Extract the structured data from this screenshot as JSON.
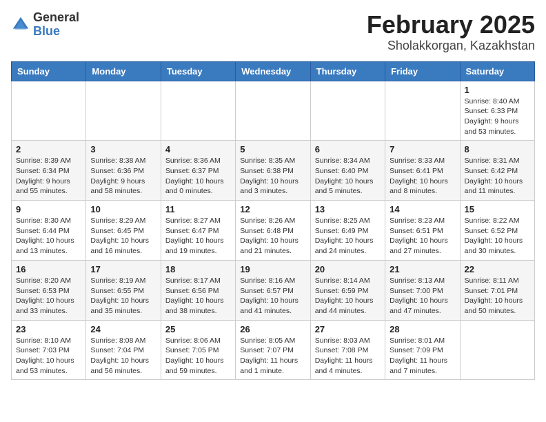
{
  "logo": {
    "general": "General",
    "blue": "Blue"
  },
  "title": {
    "main": "February 2025",
    "sub": "Sholakkorgan, Kazakhstan"
  },
  "weekdays": [
    "Sunday",
    "Monday",
    "Tuesday",
    "Wednesday",
    "Thursday",
    "Friday",
    "Saturday"
  ],
  "weeks": [
    [
      {
        "day": "",
        "info": ""
      },
      {
        "day": "",
        "info": ""
      },
      {
        "day": "",
        "info": ""
      },
      {
        "day": "",
        "info": ""
      },
      {
        "day": "",
        "info": ""
      },
      {
        "day": "",
        "info": ""
      },
      {
        "day": "1",
        "info": "Sunrise: 8:40 AM\nSunset: 6:33 PM\nDaylight: 9 hours and 53 minutes."
      }
    ],
    [
      {
        "day": "2",
        "info": "Sunrise: 8:39 AM\nSunset: 6:34 PM\nDaylight: 9 hours and 55 minutes."
      },
      {
        "day": "3",
        "info": "Sunrise: 8:38 AM\nSunset: 6:36 PM\nDaylight: 9 hours and 58 minutes."
      },
      {
        "day": "4",
        "info": "Sunrise: 8:36 AM\nSunset: 6:37 PM\nDaylight: 10 hours and 0 minutes."
      },
      {
        "day": "5",
        "info": "Sunrise: 8:35 AM\nSunset: 6:38 PM\nDaylight: 10 hours and 3 minutes."
      },
      {
        "day": "6",
        "info": "Sunrise: 8:34 AM\nSunset: 6:40 PM\nDaylight: 10 hours and 5 minutes."
      },
      {
        "day": "7",
        "info": "Sunrise: 8:33 AM\nSunset: 6:41 PM\nDaylight: 10 hours and 8 minutes."
      },
      {
        "day": "8",
        "info": "Sunrise: 8:31 AM\nSunset: 6:42 PM\nDaylight: 10 hours and 11 minutes."
      }
    ],
    [
      {
        "day": "9",
        "info": "Sunrise: 8:30 AM\nSunset: 6:44 PM\nDaylight: 10 hours and 13 minutes."
      },
      {
        "day": "10",
        "info": "Sunrise: 8:29 AM\nSunset: 6:45 PM\nDaylight: 10 hours and 16 minutes."
      },
      {
        "day": "11",
        "info": "Sunrise: 8:27 AM\nSunset: 6:47 PM\nDaylight: 10 hours and 19 minutes."
      },
      {
        "day": "12",
        "info": "Sunrise: 8:26 AM\nSunset: 6:48 PM\nDaylight: 10 hours and 21 minutes."
      },
      {
        "day": "13",
        "info": "Sunrise: 8:25 AM\nSunset: 6:49 PM\nDaylight: 10 hours and 24 minutes."
      },
      {
        "day": "14",
        "info": "Sunrise: 8:23 AM\nSunset: 6:51 PM\nDaylight: 10 hours and 27 minutes."
      },
      {
        "day": "15",
        "info": "Sunrise: 8:22 AM\nSunset: 6:52 PM\nDaylight: 10 hours and 30 minutes."
      }
    ],
    [
      {
        "day": "16",
        "info": "Sunrise: 8:20 AM\nSunset: 6:53 PM\nDaylight: 10 hours and 33 minutes."
      },
      {
        "day": "17",
        "info": "Sunrise: 8:19 AM\nSunset: 6:55 PM\nDaylight: 10 hours and 35 minutes."
      },
      {
        "day": "18",
        "info": "Sunrise: 8:17 AM\nSunset: 6:56 PM\nDaylight: 10 hours and 38 minutes."
      },
      {
        "day": "19",
        "info": "Sunrise: 8:16 AM\nSunset: 6:57 PM\nDaylight: 10 hours and 41 minutes."
      },
      {
        "day": "20",
        "info": "Sunrise: 8:14 AM\nSunset: 6:59 PM\nDaylight: 10 hours and 44 minutes."
      },
      {
        "day": "21",
        "info": "Sunrise: 8:13 AM\nSunset: 7:00 PM\nDaylight: 10 hours and 47 minutes."
      },
      {
        "day": "22",
        "info": "Sunrise: 8:11 AM\nSunset: 7:01 PM\nDaylight: 10 hours and 50 minutes."
      }
    ],
    [
      {
        "day": "23",
        "info": "Sunrise: 8:10 AM\nSunset: 7:03 PM\nDaylight: 10 hours and 53 minutes."
      },
      {
        "day": "24",
        "info": "Sunrise: 8:08 AM\nSunset: 7:04 PM\nDaylight: 10 hours and 56 minutes."
      },
      {
        "day": "25",
        "info": "Sunrise: 8:06 AM\nSunset: 7:05 PM\nDaylight: 10 hours and 59 minutes."
      },
      {
        "day": "26",
        "info": "Sunrise: 8:05 AM\nSunset: 7:07 PM\nDaylight: 11 hours and 1 minute."
      },
      {
        "day": "27",
        "info": "Sunrise: 8:03 AM\nSunset: 7:08 PM\nDaylight: 11 hours and 4 minutes."
      },
      {
        "day": "28",
        "info": "Sunrise: 8:01 AM\nSunset: 7:09 PM\nDaylight: 11 hours and 7 minutes."
      },
      {
        "day": "",
        "info": ""
      }
    ]
  ]
}
